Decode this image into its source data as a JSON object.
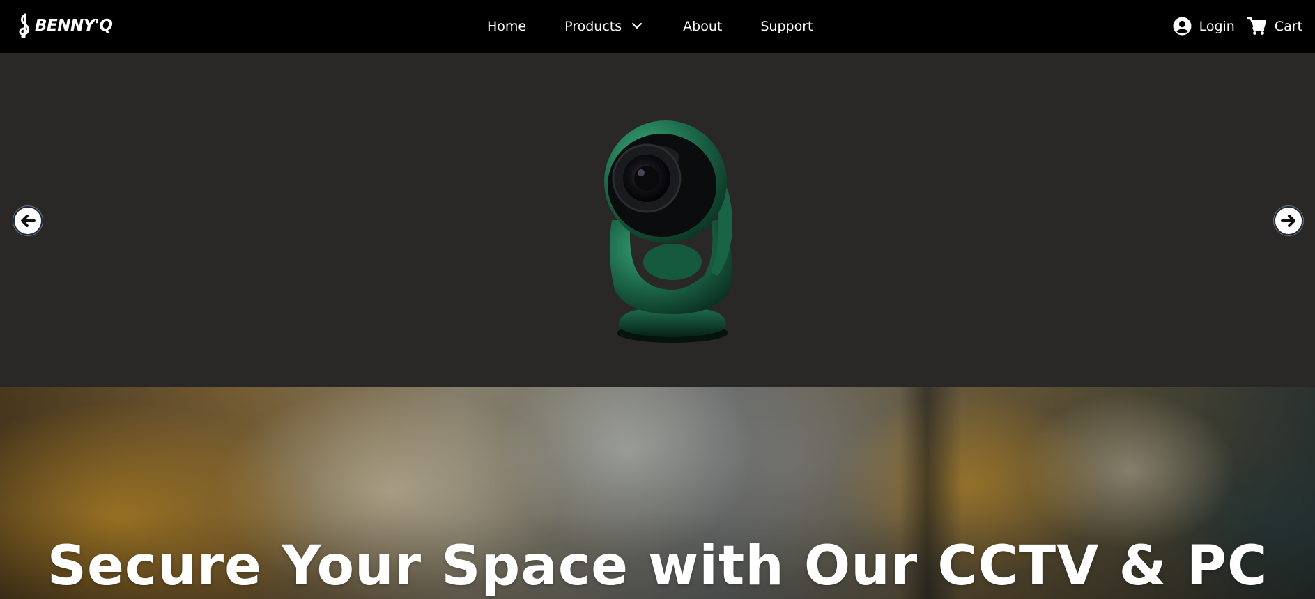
{
  "brand": {
    "name": "BENNY'Q"
  },
  "nav": {
    "items": [
      {
        "label": "Home"
      },
      {
        "label": "Products",
        "icon": "chevron-down-icon"
      },
      {
        "label": "About"
      },
      {
        "label": "Support"
      }
    ],
    "login_label": "Login",
    "login_icon": "user-circle-icon",
    "cart_label": "Cart",
    "cart_icon": "cart-icon"
  },
  "slider": {
    "image": "security-camera",
    "prev_icon": "arrow-left-icon",
    "next_icon": "arrow-right-icon",
    "background_color": "#2a2727"
  },
  "banner": {
    "title": "Secure Your Space with Our CCTV & PC"
  },
  "colors": {
    "navbar_bg": "#000000",
    "camera_green": "#1f6b4c",
    "arrow_border": "#1b2a44"
  }
}
